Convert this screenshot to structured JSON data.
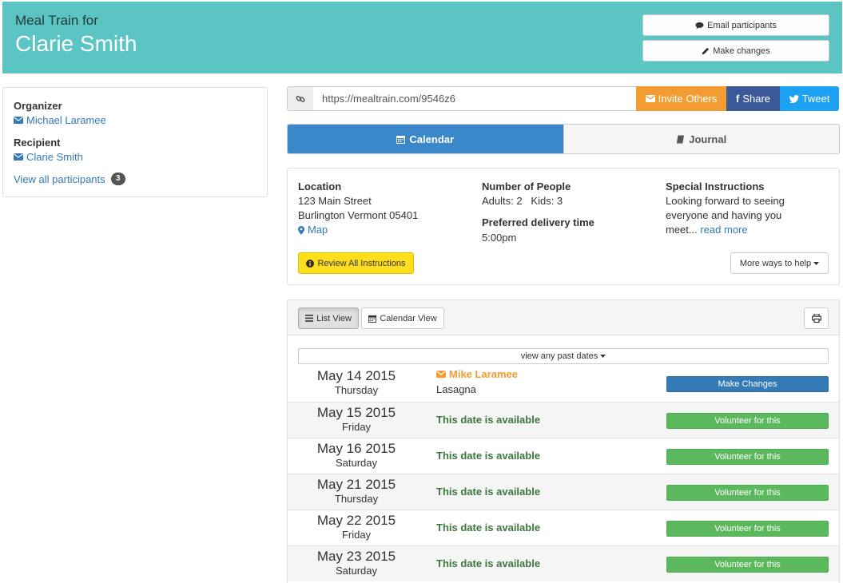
{
  "header": {
    "pretitle": "Meal Train for",
    "title": "Clarie Smith",
    "email_label": "Email participants",
    "changes_label": "Make changes"
  },
  "sidebar": {
    "organizer_heading": "Organizer",
    "organizer_name": "Michael Laramee",
    "recipient_heading": "Recipient",
    "recipient_name": "Clarie Smith",
    "view_all_label": "View all participants",
    "participant_count": "3"
  },
  "share": {
    "url": "https://mealtrain.com/9546z6",
    "invite_label": "Invite Others",
    "share_label": "Share",
    "tweet_label": "Tweet"
  },
  "tabs": {
    "calendar_label": "Calendar",
    "journal_label": "Journal"
  },
  "info": {
    "location_heading": "Location",
    "address_line1": "123 Main Street",
    "address_line2": "Burlington Vermont 05401",
    "map_label": "Map",
    "people_heading": "Number of People",
    "people_text": "Adults: 2   Kids: 3",
    "delivery_heading": "Preferred delivery time",
    "delivery_time": "5:00pm",
    "instructions_heading": "Special Instructions",
    "instructions_line1": "Looking forward to seeing",
    "instructions_line2": "everyone and having you",
    "instructions_line3": "meet...",
    "read_more_label": "read more",
    "review_label": "Review All Instructions",
    "more_ways_label": "More ways to help"
  },
  "list": {
    "list_view_label": "List View",
    "calendar_view_label": "Calendar View",
    "past_dates_label": "view any past dates",
    "booked": {
      "date": "May 14 2015",
      "day": "Thursday",
      "volunteer": "Mike Laramee",
      "meal": "Lasagna",
      "button": "Make Changes"
    },
    "available_text": "This date is available",
    "volunteer_button": "Volunteer for this",
    "rows": [
      {
        "date": "May 15 2015",
        "day": "Friday"
      },
      {
        "date": "May 16 2015",
        "day": "Saturday"
      },
      {
        "date": "May 21 2015",
        "day": "Thursday"
      },
      {
        "date": "May 22 2015",
        "day": "Friday"
      },
      {
        "date": "May 23 2015",
        "day": "Saturday"
      }
    ]
  },
  "colors": {
    "header_bg": "#5bc5c4",
    "calendar_tab": "#3a87c9",
    "invite": "#f39c32",
    "facebook": "#3b5998",
    "twitter": "#1da1f2",
    "volunteer": "#5cb85c",
    "available_text": "#3c763d",
    "review_button": "#ffdf1c"
  },
  "icons": [
    "comment-icon",
    "pencil-icon",
    "envelope-icon",
    "link-icon",
    "facebook-icon",
    "twitter-icon",
    "calendar-icon",
    "book-icon",
    "map-marker-icon",
    "info-circle-icon",
    "caret-down-icon",
    "list-icon",
    "print-icon"
  ]
}
